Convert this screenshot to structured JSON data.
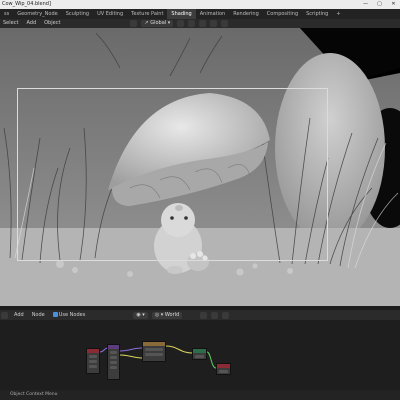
{
  "window": {
    "title": "Cow_Wip_04.blend]",
    "controls": [
      "—",
      "▢",
      "✕"
    ]
  },
  "workspaces": {
    "active_index": 5,
    "tabs": [
      "ss",
      "Geometry_Node",
      "Sculpting",
      "UV Editing",
      "Texture Paint",
      "Shading",
      "Animation",
      "Rendering",
      "Compositing",
      "Scripting",
      "+"
    ]
  },
  "viewport_header": {
    "items": [
      "Select",
      "Add",
      "Object"
    ],
    "transform_orientation": "Global"
  },
  "node_header": {
    "items": [
      "Add",
      "Node"
    ],
    "use_nodes_label": "Use Nodes",
    "use_nodes_checked": true,
    "world_name": "World"
  },
  "status_bar": {
    "text": "Object Context Menu"
  },
  "colors": {
    "accent_blue": "#4a8fe0",
    "node_output_header": "#8a2a34",
    "node_input_header": "#5a3d7a",
    "node_shader_header": "#2f6a4a",
    "link_yellow": "#d8d45a",
    "link_green": "#5fd05f",
    "link_purple": "#8b6fe0"
  }
}
